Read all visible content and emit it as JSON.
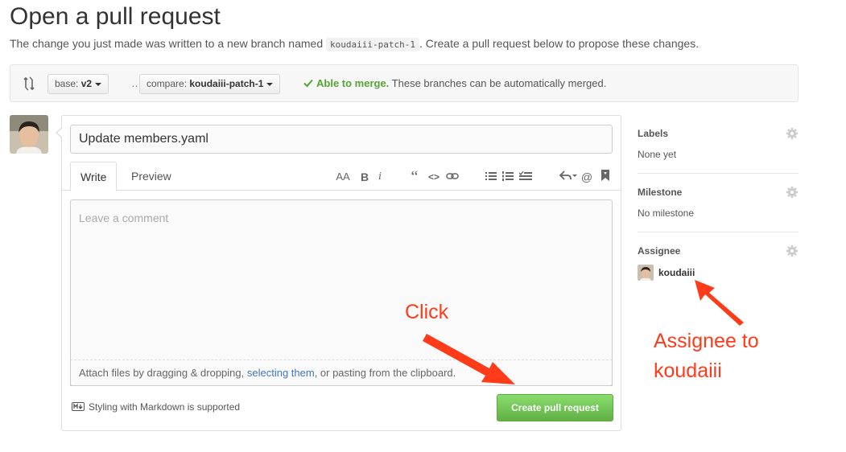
{
  "page": {
    "title": "Open a pull request",
    "subtitle_before": "The change you just made was written to a new branch named ",
    "branch_code": "koudaiii-patch-1",
    "subtitle_after": ". Create a pull request below to propose these changes."
  },
  "compare": {
    "base_prefix": "base: ",
    "base_value": "v2",
    "ellipsis": "…",
    "compare_prefix": "compare: ",
    "compare_value": "koudaiii-patch-1",
    "merge_ok": "Able to merge.",
    "merge_text": " These branches can be automatically merged.",
    "merge_color": "#55a532"
  },
  "form": {
    "title_value": "Update members.yaml",
    "tabs": [
      {
        "label": "Write",
        "active": true
      },
      {
        "label": "Preview",
        "active": false
      }
    ],
    "toolbar": {
      "heading": "AA",
      "bold": "B",
      "italic": "i",
      "quote": "“",
      "code": "<>",
      "mention": "@"
    },
    "comment_placeholder": "Leave a comment",
    "attach_before": "Attach files by dragging & dropping, ",
    "attach_link": "selecting them",
    "attach_after": ", or pasting from the clipboard.",
    "markdown_note": "Styling with Markdown is supported",
    "create_button": "Create pull request",
    "button_color": "#60b044"
  },
  "sidebar": {
    "labels_heading": "Labels",
    "labels_value": "None yet",
    "milestone_heading": "Milestone",
    "milestone_value": "No milestone",
    "assignee_heading": "Assignee",
    "assignee_value": "koudaiii"
  },
  "annotations": {
    "click": "Click",
    "assignee_line1": "Assignee to",
    "assignee_line2": "koudaiii",
    "color": "#ff3b1a"
  }
}
